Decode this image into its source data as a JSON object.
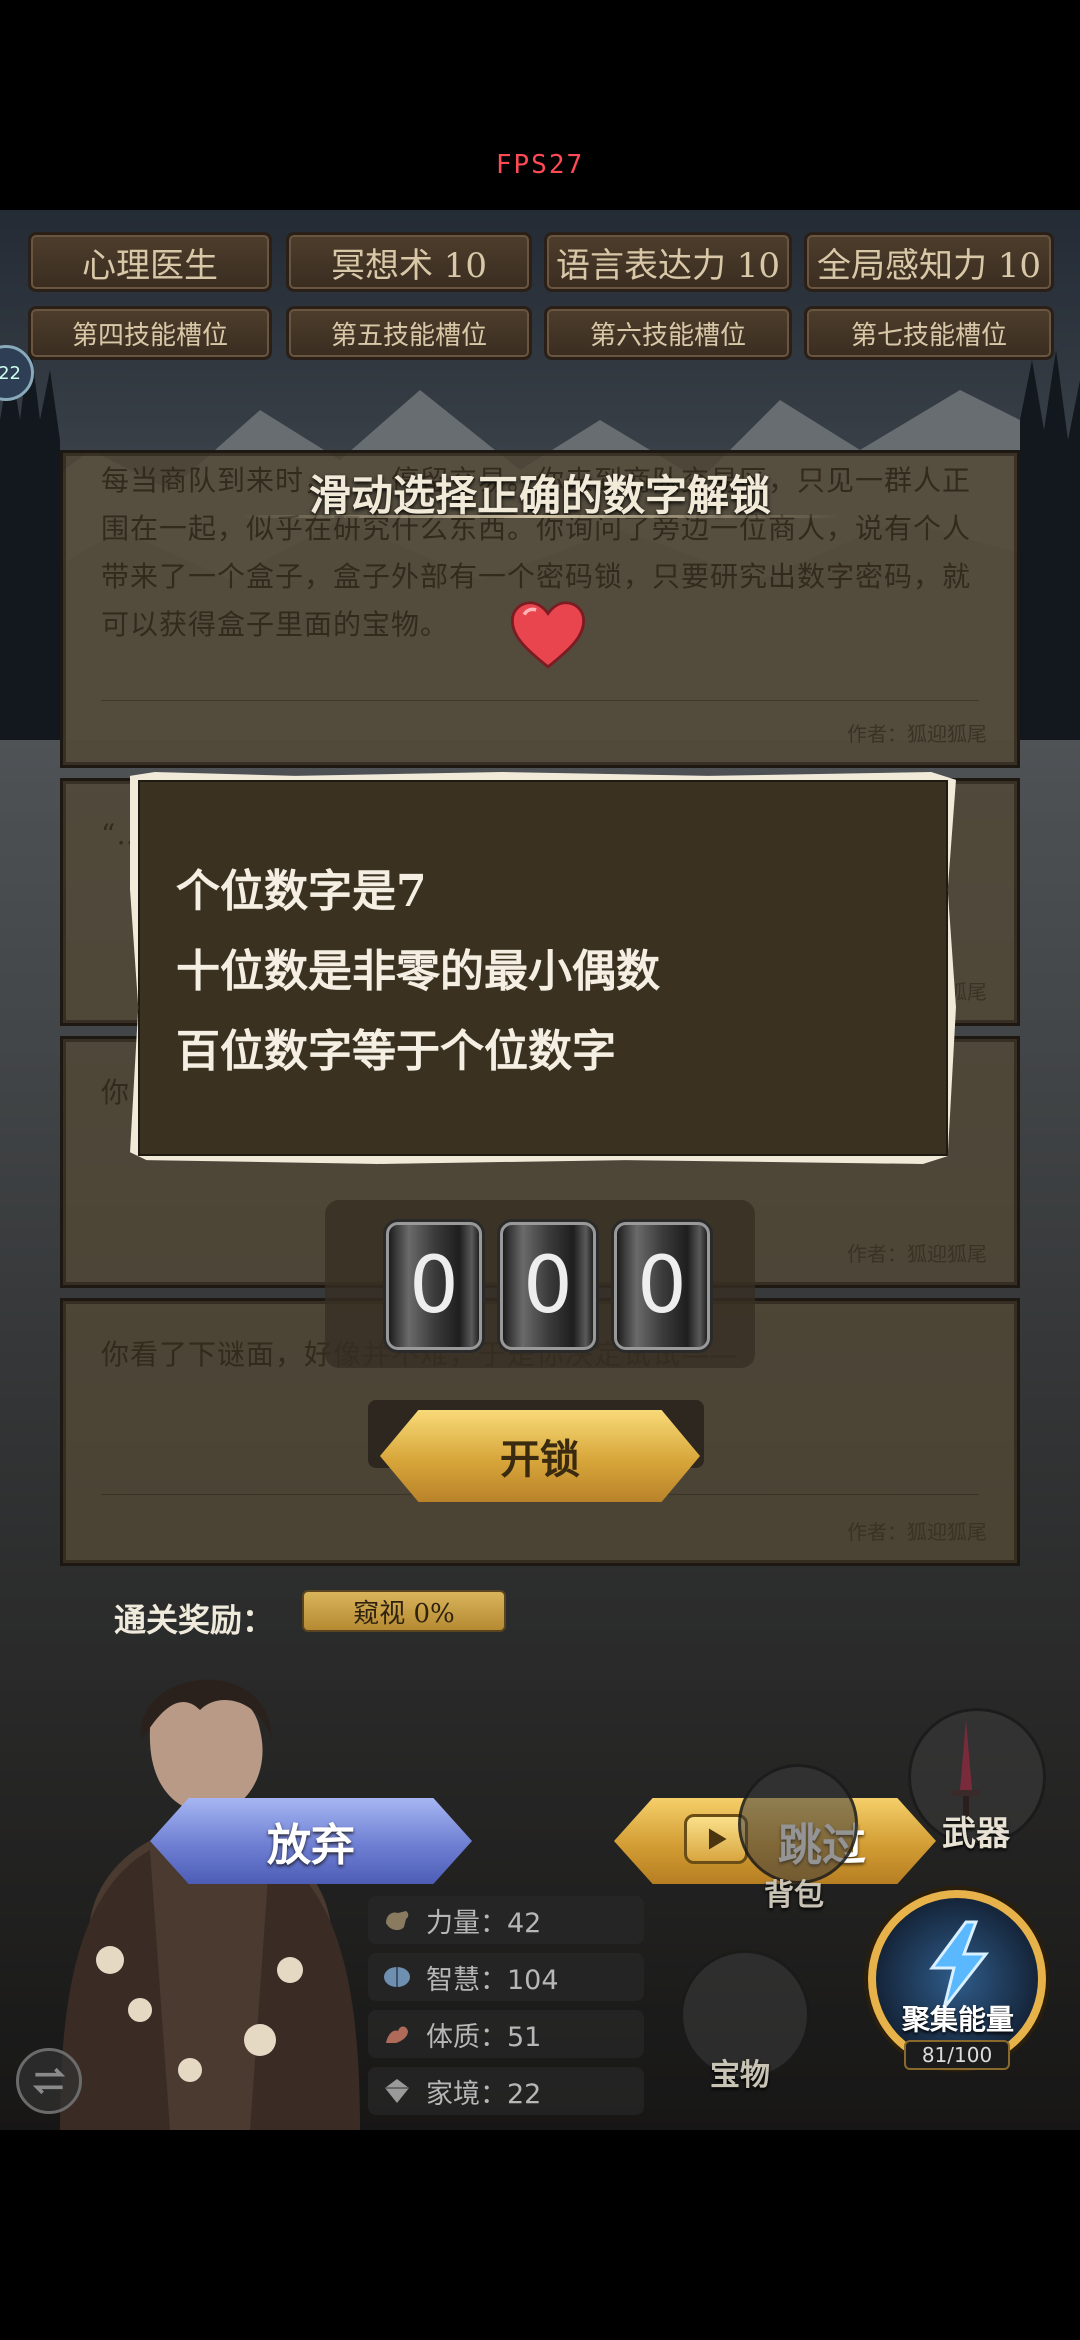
{
  "fps": "FPS27",
  "skills_row1": [
    "心理医生",
    "冥想术 10",
    "语言表达力 10",
    "全局感知力 10"
  ],
  "skills_row2": [
    "第四技能槽位",
    "第五技能槽位",
    "第六技能槽位",
    "第七技能槽位"
  ],
  "level_badge": "22",
  "story_cards": [
    {
      "text": "每当商队到来时，……停留交易。你来到商队交易区，只见一群人正围在一起，似乎在研究什么东西。你询问了旁边一位商人，说有个人带来了一个盒子，盒子外部有一个密码锁，只要研究出数字密码，就可以获得盒子里面的宝物。",
      "author": "作者：狐迎狐尾"
    },
    {
      "text": "“…",
      "author": "作者：狐迎狐尾"
    },
    {
      "text": "你…",
      "author": "作者：狐迎狐尾"
    },
    {
      "text": "你看了下谜面，好像并不难，于是你决定试试——",
      "author": "作者：狐迎狐尾"
    }
  ],
  "dialog": {
    "title": "滑动选择正确的数字解锁",
    "clues": [
      "个位数字是7",
      "十位数是非零的最小偶数",
      "百位数字等于个位数字"
    ],
    "digits": [
      "0",
      "0",
      "0"
    ],
    "unlock_label": "开锁"
  },
  "reward": {
    "label": "通关奖励：",
    "value": "窥视 0%"
  },
  "actions": {
    "give_up": "放弃",
    "skip": "跳过"
  },
  "stats": [
    {
      "icon": "strength-icon",
      "label": "力量：42"
    },
    {
      "icon": "wisdom-icon",
      "label": "智慧：104"
    },
    {
      "icon": "physique-icon",
      "label": "体质：51"
    },
    {
      "icon": "family-icon",
      "label": "家境：22"
    }
  ],
  "side_menu": {
    "weapon": "武器",
    "bag": "背包",
    "treasure": "宝物"
  },
  "energy": {
    "label": "聚集能量",
    "count": "81/100",
    "progress": 0.81
  },
  "colors": {
    "accent_gold": "#d7a63a",
    "giveup_blue": "#6e7fd3",
    "fps_red": "#ff4a55"
  }
}
